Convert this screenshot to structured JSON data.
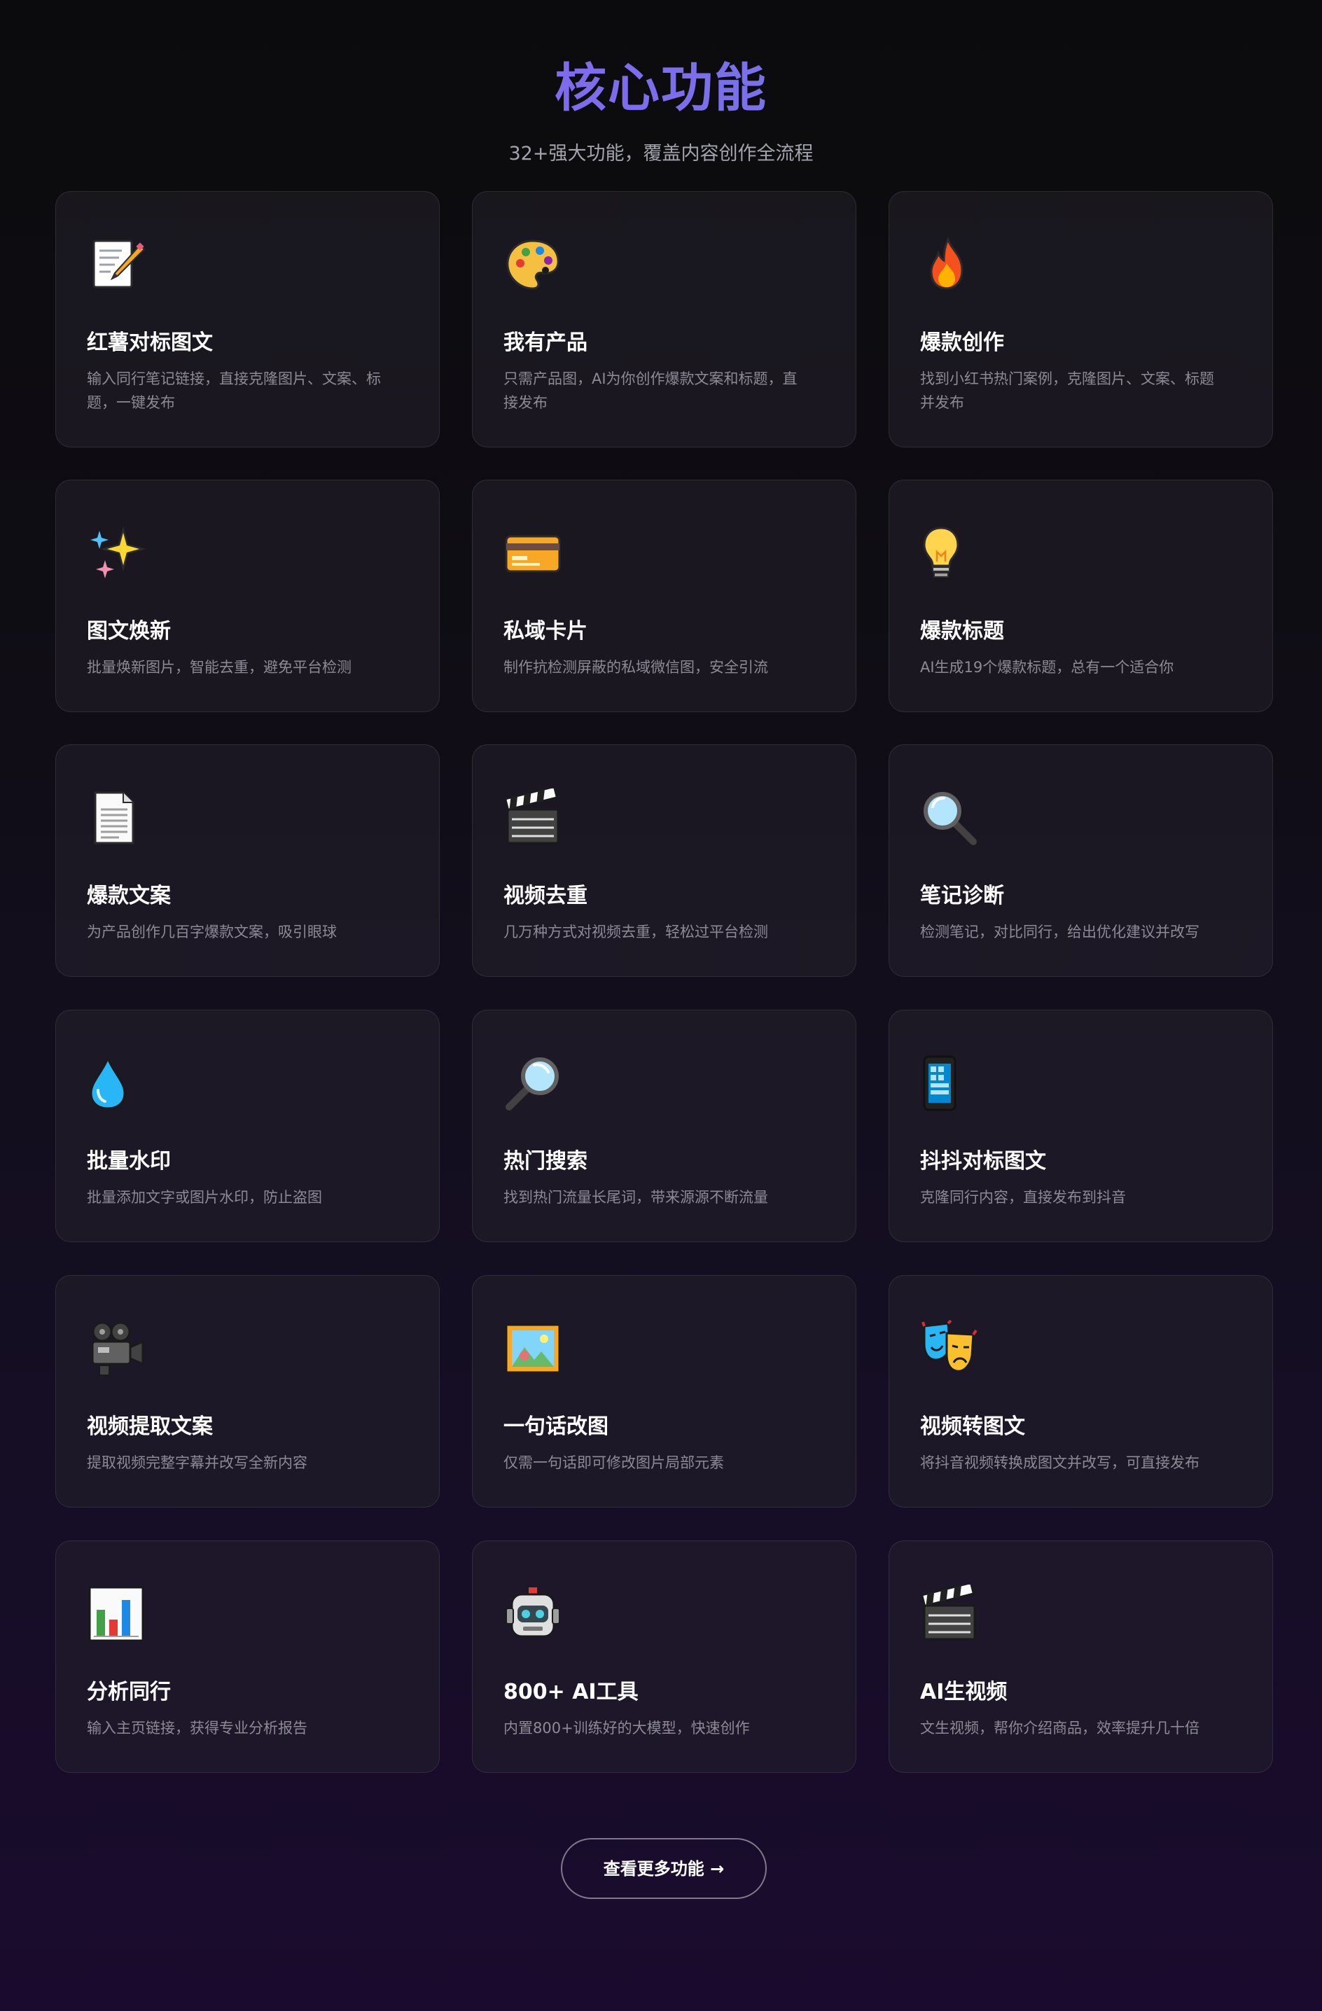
{
  "header": {
    "title": "核心功能",
    "subtitle": "32+强大功能，覆盖内容创作全流程"
  },
  "colors": {
    "title_gradient_start": "#8b5cf6",
    "title_gradient_end": "#6d7fe0",
    "card_title": "#ffffff",
    "card_desc": "#8d8a96"
  },
  "features": [
    {
      "icon": "memo-icon",
      "title": "红薯对标图文",
      "desc": "输入同行笔记链接，直接克隆图片、文案、标题，一键发布"
    },
    {
      "icon": "palette-icon",
      "title": "我有产品",
      "desc": "只需产品图，AI为你创作爆款文案和标题，直接发布"
    },
    {
      "icon": "fire-icon",
      "title": "爆款创作",
      "desc": "找到小红书热门案例，克隆图片、文案、标题并发布"
    },
    {
      "icon": "sparkles-icon",
      "title": "图文焕新",
      "desc": "批量焕新图片，智能去重，避免平台检测"
    },
    {
      "icon": "credit-card-icon",
      "title": "私域卡片",
      "desc": "制作抗检测屏蔽的私域微信图，安全引流"
    },
    {
      "icon": "light-bulb-icon",
      "title": "爆款标题",
      "desc": "AI生成19个爆款标题，总有一个适合你"
    },
    {
      "icon": "document-icon",
      "title": "爆款文案",
      "desc": "为产品创作几百字爆款文案，吸引眼球"
    },
    {
      "icon": "clapper-board-icon",
      "title": "视频去重",
      "desc": "几万种方式对视频去重，轻松过平台检测"
    },
    {
      "icon": "magnifier-left-icon",
      "title": "笔记诊断",
      "desc": "检测笔记，对比同行，给出优化建议并改写"
    },
    {
      "icon": "droplet-icon",
      "title": "批量水印",
      "desc": "批量添加文字或图片水印，防止盗图"
    },
    {
      "icon": "magnifier-right-icon",
      "title": "热门搜索",
      "desc": "找到热门流量长尾词，带来源源不断流量"
    },
    {
      "icon": "mobile-phone-icon",
      "title": "抖抖对标图文",
      "desc": "克隆同行内容，直接发布到抖音"
    },
    {
      "icon": "movie-camera-icon",
      "title": "视频提取文案",
      "desc": "提取视频完整字幕并改写全新内容"
    },
    {
      "icon": "framed-picture-icon",
      "title": "一句话改图",
      "desc": "仅需一句话即可修改图片局部元素"
    },
    {
      "icon": "performing-arts-icon",
      "title": "视频转图文",
      "desc": "将抖音视频转换成图文并改写，可直接发布"
    },
    {
      "icon": "bar-chart-icon",
      "title": "分析同行",
      "desc": "输入主页链接，获得专业分析报告"
    },
    {
      "icon": "robot-icon",
      "title": "800+ AI工具",
      "desc": "内置800+训练好的大模型，快速创作"
    },
    {
      "icon": "clapper-board-icon",
      "title": "AI生视频",
      "desc": "文生视频，帮你介绍商品，效率提升几十倍"
    }
  ],
  "more_button": {
    "label": "查看更多功能 →"
  }
}
